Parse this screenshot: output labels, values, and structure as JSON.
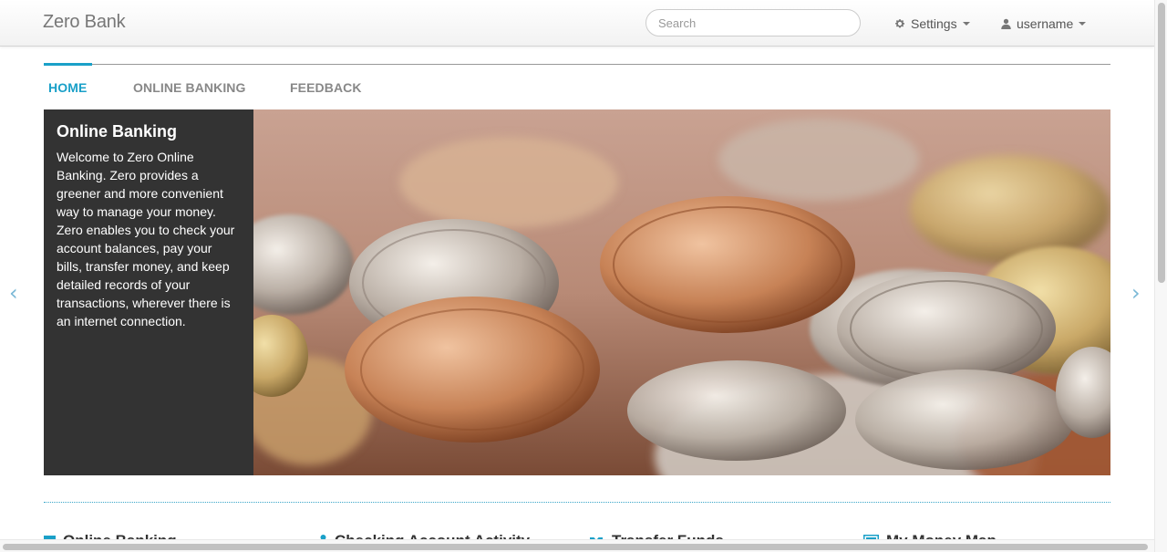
{
  "header": {
    "brand": "Zero Bank",
    "search_placeholder": "Search",
    "settings_label": "Settings",
    "user_label": "username"
  },
  "tabs": [
    {
      "label": "HOME",
      "active": true
    },
    {
      "label": "ONLINE BANKING",
      "active": false
    },
    {
      "label": "FEEDBACK",
      "active": false
    }
  ],
  "carousel": {
    "title": "Online Banking",
    "text": "Welcome to Zero Online Banking. Zero provides a greener and more convenient way to manage your money. Zero enables you to check your account balances, pay your bills, transfer money, and keep detailed records of your transactions, wherever there is an internet connection.",
    "prev_icon": "chevron-left-icon",
    "next_icon": "chevron-right-icon"
  },
  "features": [
    {
      "label": "Online Banking",
      "icon": "square-icon"
    },
    {
      "label": "Checking Account Activity",
      "icon": "user-icon"
    },
    {
      "label": "Transfer Funds",
      "icon": "shuffle-icon"
    },
    {
      "label": "My Money Map",
      "icon": "monitor-icon"
    }
  ],
  "colors": {
    "accent": "#1aa0c8",
    "caption_bg": "#333333"
  }
}
